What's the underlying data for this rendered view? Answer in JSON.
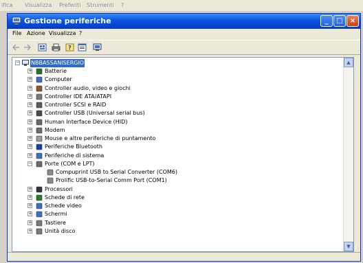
{
  "background_menu": [
    "ifica",
    "Visualizza",
    "Preferiti",
    "Strumenti",
    "?"
  ],
  "window": {
    "title": "Gestione periferiche"
  },
  "menu": [
    "File",
    "Azione",
    "Visualizza",
    "?"
  ],
  "tree": {
    "root": "NBBASSANISERGIO",
    "items": [
      {
        "label": "Batterie",
        "icon": "battery-icon",
        "color": "#2b6f2b"
      },
      {
        "label": "Computer",
        "icon": "computer-icon",
        "color": "#3b6fc4"
      },
      {
        "label": "Controller audio, video e giochi",
        "icon": "audio-icon",
        "color": "#8a5a2b"
      },
      {
        "label": "Controller IDE ATA/ATAPI",
        "icon": "ide-icon",
        "color": "#7a7a7a"
      },
      {
        "label": "Controller SCSI e RAID",
        "icon": "scsi-icon",
        "color": "#5a5a5a"
      },
      {
        "label": "Controller USB (Universal serial bus)",
        "icon": "usb-icon",
        "color": "#4a4a4a"
      },
      {
        "label": "Human Interface Device (HID)",
        "icon": "hid-icon",
        "color": "#6a6a6a"
      },
      {
        "label": "Modem",
        "icon": "modem-icon",
        "color": "#6a6a6a"
      },
      {
        "label": "Mouse e altre periferiche di puntamento",
        "icon": "mouse-icon",
        "color": "#9a9a9a"
      },
      {
        "label": "Periferiche Bluetooth",
        "icon": "bluetooth-icon",
        "color": "#1a3fa8"
      },
      {
        "label": "Periferiche di sistema",
        "icon": "system-icon",
        "color": "#3b6fc4"
      },
      {
        "label": "Porte (COM e LPT)",
        "icon": "port-icon",
        "color": "#6a6a6a"
      }
    ],
    "ports_children": [
      "Compuprint USB to Serial Converter (COM6)",
      "Prolific USB-to-Serial Comm Port (COM1)"
    ],
    "items_after": [
      {
        "label": "Processori",
        "icon": "processor-icon",
        "color": "#333333"
      },
      {
        "label": "Schede di rete",
        "icon": "network-icon",
        "color": "#2b7a2b"
      },
      {
        "label": "Schede video",
        "icon": "video-icon",
        "color": "#3b6fc4"
      },
      {
        "label": "Schermi",
        "icon": "monitor-icon",
        "color": "#3b6fc4"
      },
      {
        "label": "Tastiere",
        "icon": "keyboard-icon",
        "color": "#7a7a7a"
      },
      {
        "label": "Unità disco",
        "icon": "disk-icon",
        "color": "#7a7a7a"
      }
    ]
  },
  "colors": {
    "title_bar": "#0a54e0",
    "selection": "#316ac5"
  }
}
